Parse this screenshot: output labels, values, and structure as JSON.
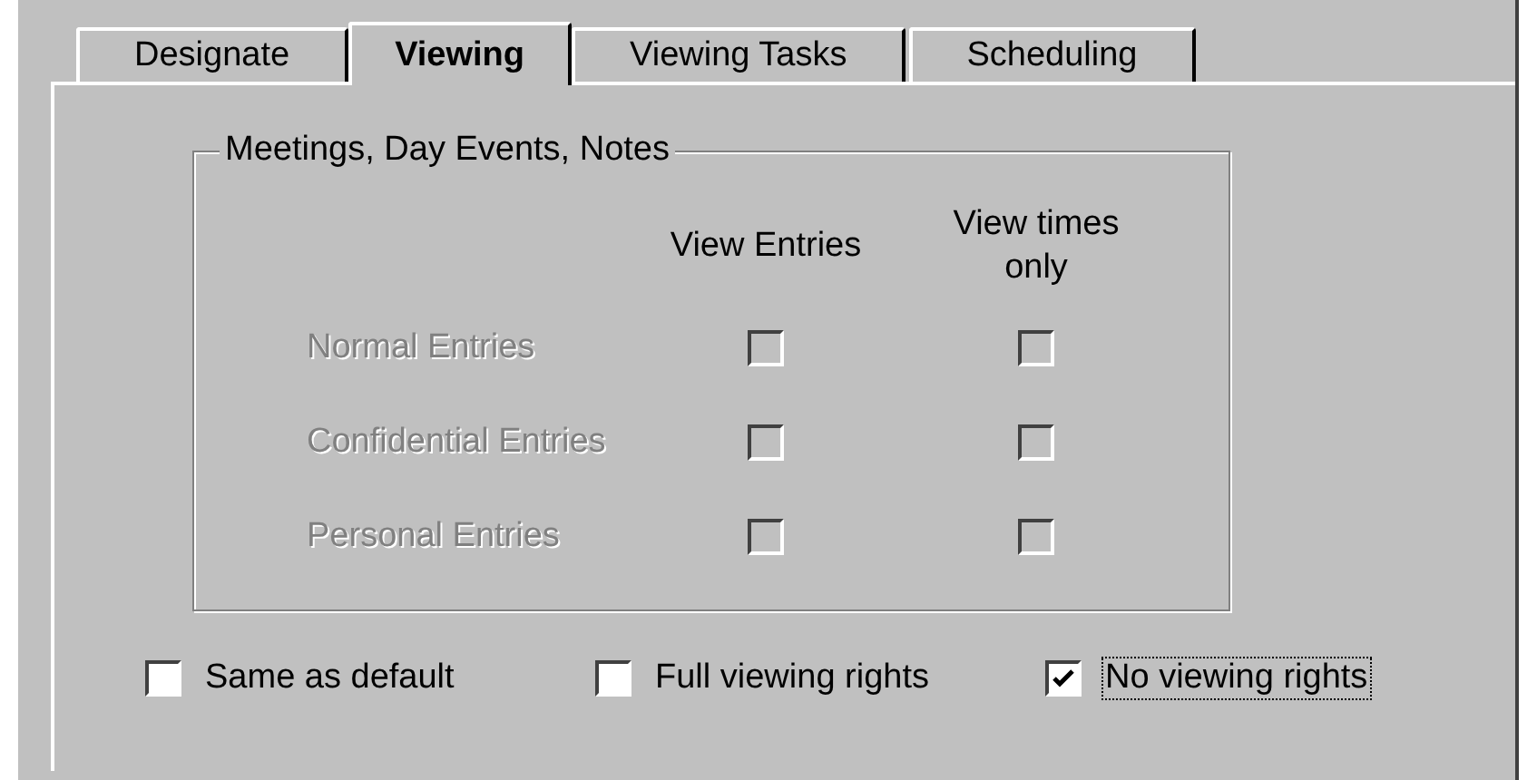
{
  "tabs": [
    {
      "label": "Designate",
      "selected": false
    },
    {
      "label": "Viewing",
      "selected": true
    },
    {
      "label": "Viewing Tasks",
      "selected": false
    },
    {
      "label": "Scheduling",
      "selected": false
    }
  ],
  "group": {
    "title": "Meetings, Day Events, Notes",
    "columns": [
      "View Entries",
      "View times only"
    ],
    "rows": [
      {
        "label": "Normal Entries",
        "disabled": true,
        "view_entries": false,
        "view_times_only": false
      },
      {
        "label": "Confidential Entries",
        "disabled": true,
        "view_entries": false,
        "view_times_only": false
      },
      {
        "label": "Personal Entries",
        "disabled": true,
        "view_entries": false,
        "view_times_only": false
      }
    ]
  },
  "options": [
    {
      "label": "Same as default",
      "checked": false,
      "focused": false
    },
    {
      "label": "Full viewing rights",
      "checked": false,
      "focused": false
    },
    {
      "label": "No viewing rights",
      "checked": true,
      "focused": true
    }
  ]
}
